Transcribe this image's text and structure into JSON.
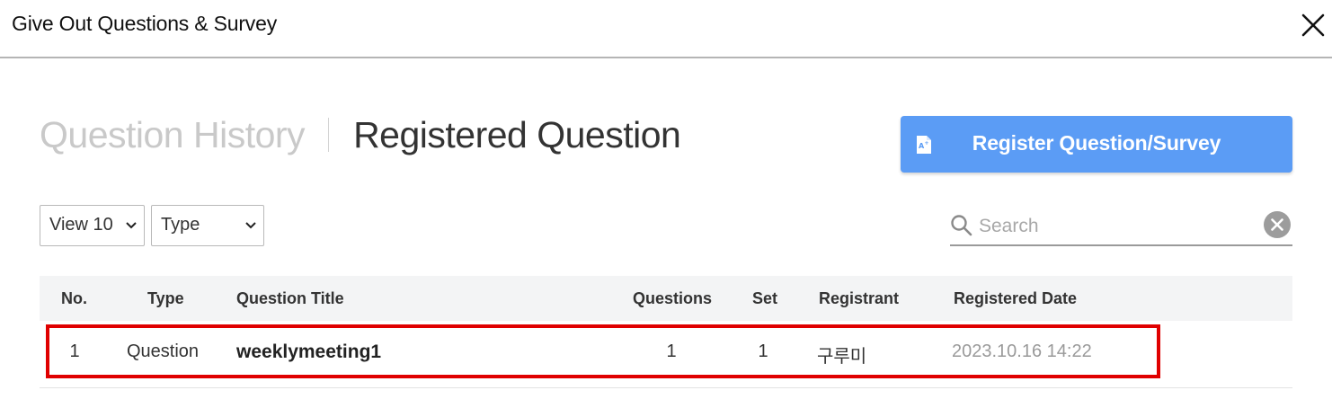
{
  "dialog": {
    "title": "Give Out Questions & Survey",
    "close_icon": "close-icon"
  },
  "tabs": [
    {
      "label": "Question History",
      "active": false
    },
    {
      "label": "Registered Question",
      "active": true
    }
  ],
  "register_button": {
    "label": "Register Question/Survey",
    "icon": "document-text-icon",
    "color": "#5b9cf5"
  },
  "filters": {
    "view": {
      "selected": "View 10"
    },
    "type": {
      "selected": "Type"
    }
  },
  "search": {
    "placeholder": "Search",
    "value": "",
    "icon": "search-icon",
    "clear_icon": "clear-icon"
  },
  "table": {
    "columns": [
      "No.",
      "Type",
      "Question Title",
      "Questions",
      "Set",
      "Registrant",
      "Registered Date"
    ],
    "rows": [
      {
        "no": "1",
        "type": "Question",
        "title": "weeklymeeting1",
        "questions": "1",
        "set": "1",
        "registrant": "구루미",
        "date": "2023.10.16 14:22"
      }
    ]
  },
  "colors": {
    "accent": "#5b9cf5",
    "highlight": "#e00000"
  }
}
